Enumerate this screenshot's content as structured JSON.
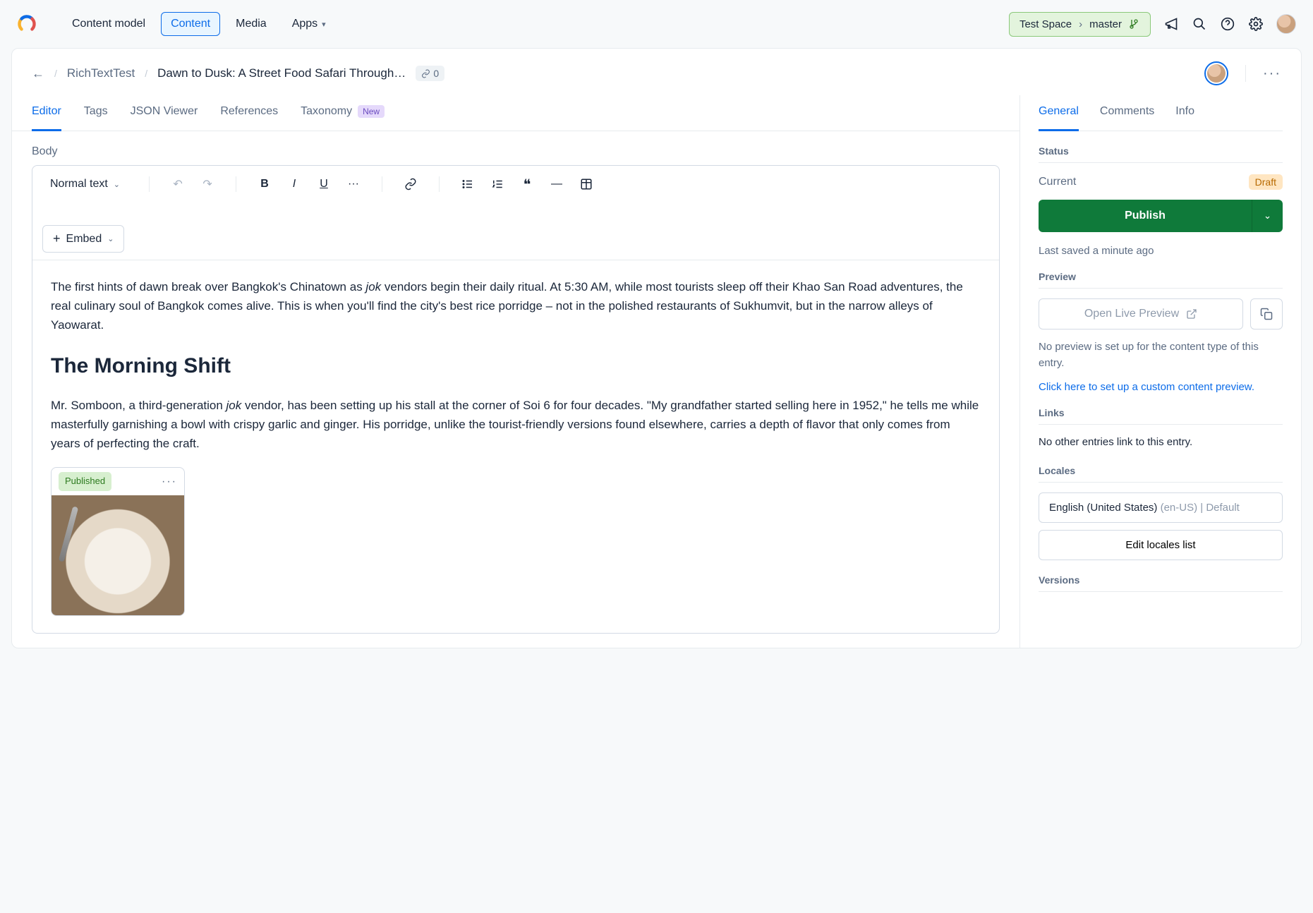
{
  "topnav": {
    "items": [
      "Content model",
      "Content",
      "Media",
      "Apps"
    ],
    "active_index": 1
  },
  "space_selector": {
    "space": "Test Space",
    "env": "master"
  },
  "breadcrumb": {
    "parent": "RichTextTest",
    "title": "Dawn to Dusk: A Street Food Safari Through…",
    "links_count": "0"
  },
  "editor_tabs": {
    "items": [
      "Editor",
      "Tags",
      "JSON Viewer",
      "References",
      "Taxonomy"
    ],
    "badge_text": "New",
    "active_index": 0
  },
  "field_label": "Body",
  "rte": {
    "format_label": "Normal text",
    "embed_label": "Embed"
  },
  "content": {
    "p1_a": "The first hints of dawn break over Bangkok's Chinatown as ",
    "p1_em": "jok",
    "p1_b": " vendors begin their daily ritual. At 5:30 AM, while most tourists sleep off their Khao San Road adventures, the real culinary soul of Bangkok comes alive. This is when you'll find the city's best rice porridge – not in the polished restaurants of Sukhumvit, but in the narrow alleys of Yaowarat.",
    "h2": "The Morning Shift",
    "p2_a": "Mr. Somboon, a third-generation ",
    "p2_em": "jok",
    "p2_b": " vendor, has been setting up his stall at the corner of Soi 6 for four decades. \"My grandfather started selling here in 1952,\" he tells me while masterfully garnishing a bowl with crispy garlic and ginger. His porridge, unlike the tourist-friendly versions found elsewhere, carries a depth of flavor that only comes from years of perfecting the craft.",
    "asset_status": "Published"
  },
  "side_tabs": {
    "items": [
      "General",
      "Comments",
      "Info"
    ],
    "active_index": 0
  },
  "status": {
    "heading": "Status",
    "current_label": "Current",
    "state": "Draft",
    "publish_label": "Publish",
    "saved_text": "Last saved a minute ago"
  },
  "preview": {
    "heading": "Preview",
    "open_label": "Open Live Preview",
    "no_preview_text": "No preview is set up for the content type of this entry.",
    "setup_link": "Click here to set up a custom content preview."
  },
  "links": {
    "heading": "Links",
    "text": "No other entries link to this entry."
  },
  "locales": {
    "heading": "Locales",
    "name": "English (United States)",
    "suffix": "(en-US) | Default",
    "edit_label": "Edit locales list"
  },
  "versions": {
    "heading": "Versions"
  }
}
